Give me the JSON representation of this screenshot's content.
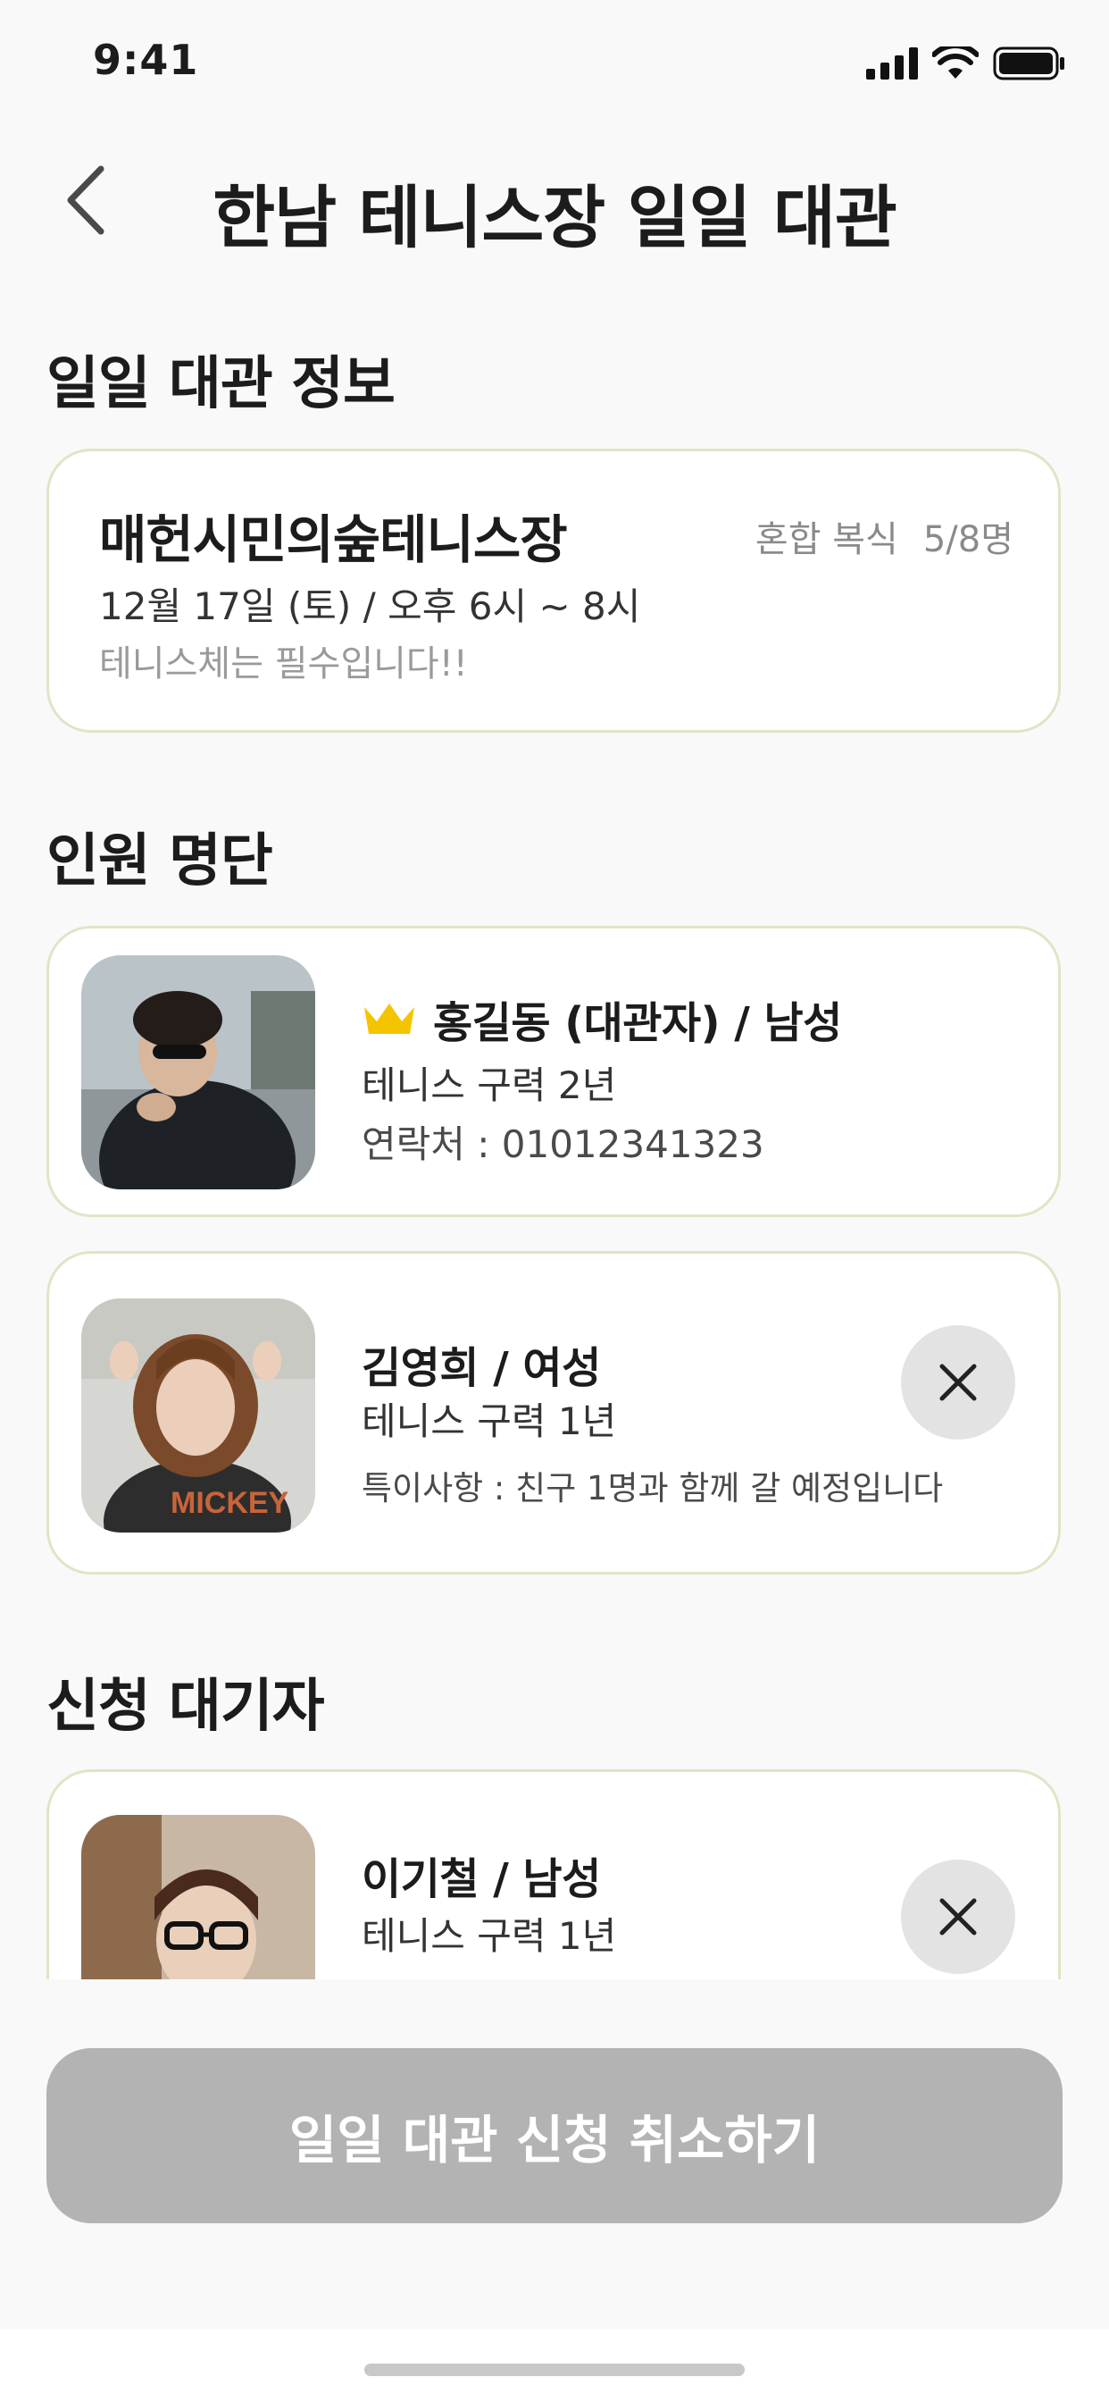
{
  "status_bar": {
    "time": "9:41"
  },
  "header": {
    "title": "한남 테니스장 일일 대관"
  },
  "rental_info": {
    "section_title": "일일 대관 정보",
    "venue_name": "매헌시민의숲테니스장",
    "game_type": "혼합 복식",
    "capacity": "5/8명",
    "date_time": "12월 17일 (토) / 오후 6시 ~ 8시",
    "note": "테니스체는 필수입니다!!"
  },
  "members": {
    "section_title": "인원 명단",
    "list": [
      {
        "name": "홍길동 (대관자) / 남성",
        "career": "테니스 구력 2년",
        "extra": "연락처 :  01012341323",
        "is_host": true
      },
      {
        "name": "김영희 / 여성",
        "career": "테니스 구력 1년",
        "extra": "특이사항 : 친구 1명과 함께 갈 예정입니다",
        "is_host": false
      }
    ]
  },
  "waitlist": {
    "section_title": "신청 대기자",
    "list": [
      {
        "name": "이기철 / 남성",
        "career": "테니스 구력 1년"
      }
    ]
  },
  "footer": {
    "cancel_label": "일일 대관 신청 취소하기"
  },
  "colors": {
    "card_border": "#e2e4c6",
    "crown": "#f5c400",
    "disabled_button": "#b3b3b3",
    "remove_bg": "#e3e3e3"
  },
  "icons": [
    "back-chevron-icon",
    "signal-icon",
    "wifi-icon",
    "battery-icon",
    "crown-icon",
    "close-icon"
  ]
}
